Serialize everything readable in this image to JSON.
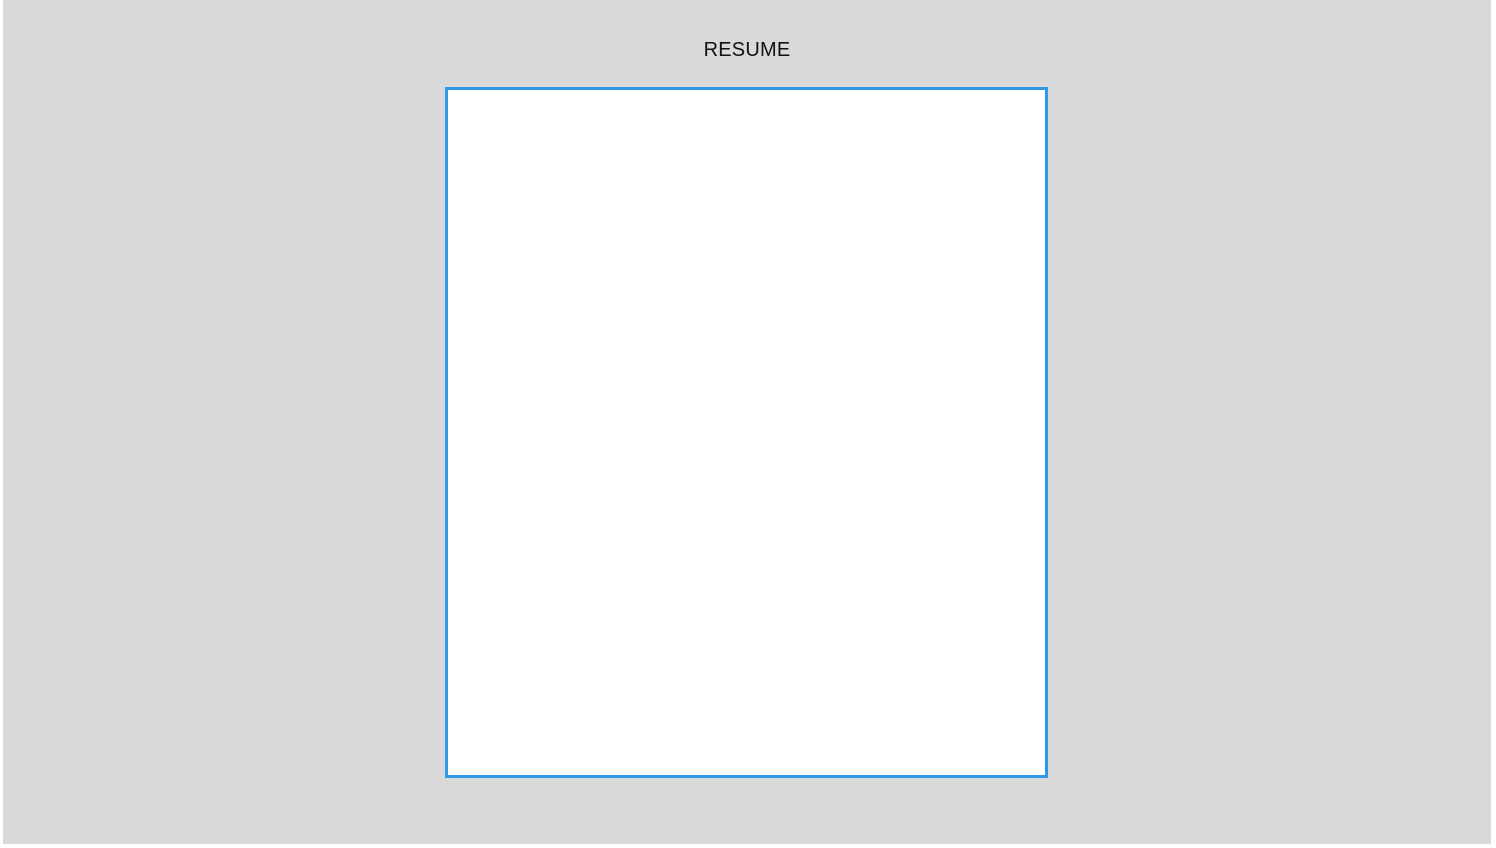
{
  "header": {
    "title": "RESUME"
  },
  "colors": {
    "background": "#d9d9d9",
    "page": "#ffffff",
    "selection_border": "#2e9ae6"
  },
  "document": {
    "selected": true
  }
}
